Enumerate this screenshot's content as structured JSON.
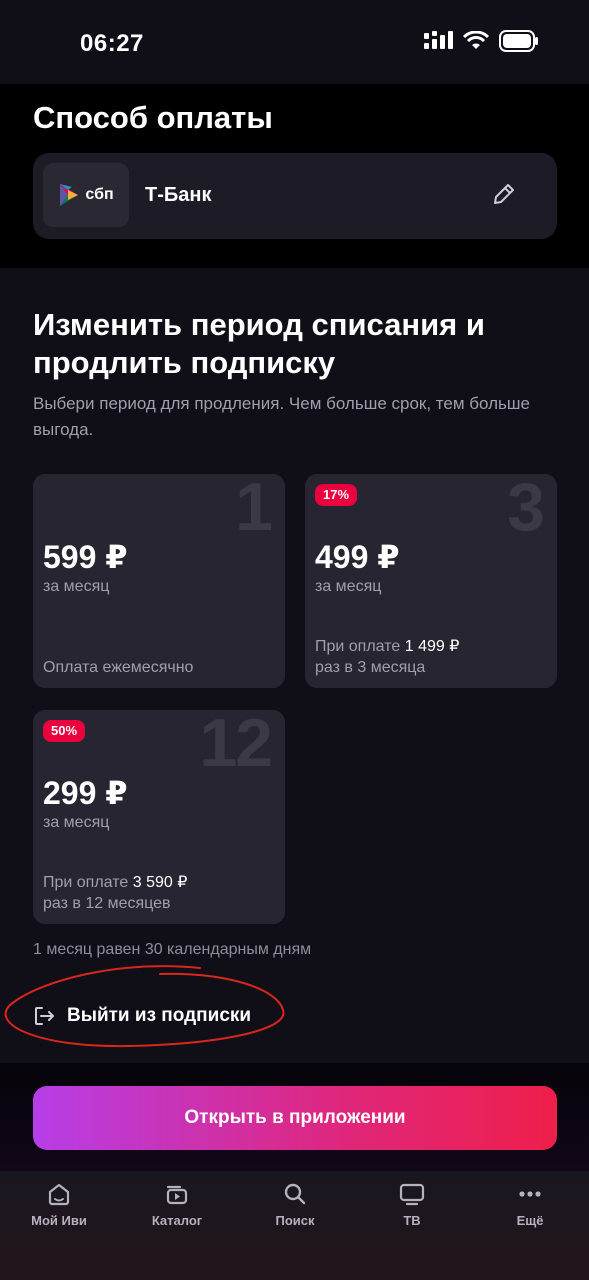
{
  "status_bar": {
    "time": "06:27"
  },
  "payment": {
    "title": "Способ оплаты",
    "logo_text": "сбп",
    "bank": "Т-Банк"
  },
  "renew": {
    "title": "Изменить период списания и продлить подписку",
    "subtitle": "Выбери период для продления. Чем больше срок, тем больше выгода."
  },
  "plans": [
    {
      "months": "1",
      "badge": "",
      "price": "599 ₽",
      "per": "за месяц",
      "note": "Оплата ежемесячно",
      "note_pre": "",
      "note_amount": "",
      "note_post": ""
    },
    {
      "months": "3",
      "badge": "17%",
      "price": "499 ₽",
      "per": "за месяц",
      "note": "",
      "note_pre": "При оплате",
      "note_amount": "1 499 ₽",
      "note_post": "раз в 3 месяца"
    },
    {
      "months": "12",
      "badge": "50%",
      "price": "299 ₽",
      "per": "за месяц",
      "note": "",
      "note_pre": "При оплате",
      "note_amount": "3 590 ₽",
      "note_post": "раз в 12 месяцев"
    }
  ],
  "footnote": "1 месяц равен 30 календарным дням",
  "leave_label": "Выйти из подписки",
  "cta_label": "Открыть в приложении",
  "tabs": [
    {
      "label": "Мой Иви",
      "icon": "home-icon"
    },
    {
      "label": "Каталог",
      "icon": "catalog-icon"
    },
    {
      "label": "Поиск",
      "icon": "search-icon"
    },
    {
      "label": "ТВ",
      "icon": "tv-icon"
    },
    {
      "label": "Ещё",
      "icon": "more-icon"
    }
  ],
  "colors": {
    "accent_red": "#ea003d",
    "cta_start": "#b63ee8",
    "cta_end": "#ee1f4a",
    "annotation": "#d8261d"
  }
}
